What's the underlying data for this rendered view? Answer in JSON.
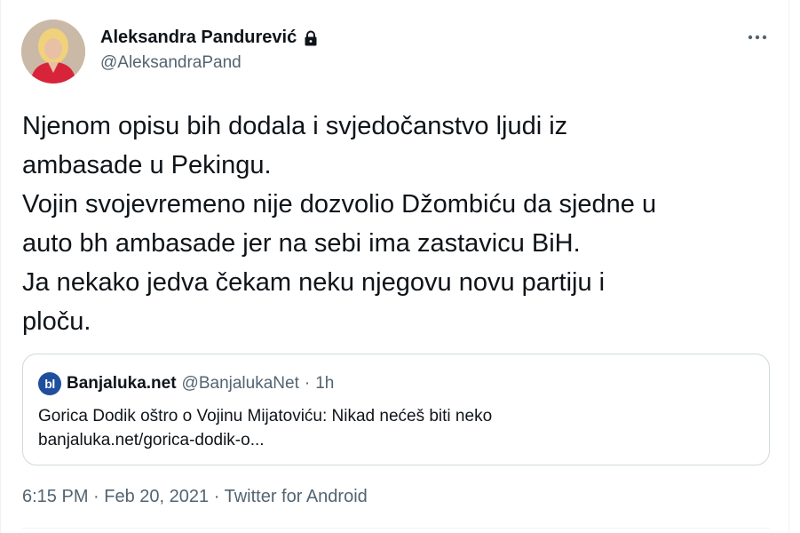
{
  "author": {
    "display_name": "Aleksandra Pandurević",
    "handle": "@AleksandraPand",
    "protected_icon": "lock-icon"
  },
  "menu_icon": "more-horizontal-icon",
  "tweet": {
    "text": "Njenom opisu bih dodala i svjedočanstvo ljudi iz\nambasade u Pekingu.\nVojin svojevremeno nije dozvolio Džombiću da sjedne u\nauto bh ambasade jer na sebi ima zastavicu BiH.\nJa nekako jedva čekam neku njegovu novu partiju i\nploču."
  },
  "quote": {
    "logo_text": "bl",
    "name": "Banjaluka.net",
    "handle": "@BanjalukaNet",
    "separator": "·",
    "time": "1h",
    "title": "Gorica Dodik oštro o Vojinu Mijatoviću: Nikad nećeš biti neko",
    "link": "banjaluka.net/gorica-dodik-o..."
  },
  "meta": {
    "time": "6:15 PM",
    "separator": "·",
    "date": "Feb 20, 2021",
    "source": "Twitter for Android"
  },
  "colors": {
    "text": "#0f1419",
    "secondary": "#536471",
    "border": "#cfd9de",
    "logo_bg": "#1f4e9c"
  }
}
